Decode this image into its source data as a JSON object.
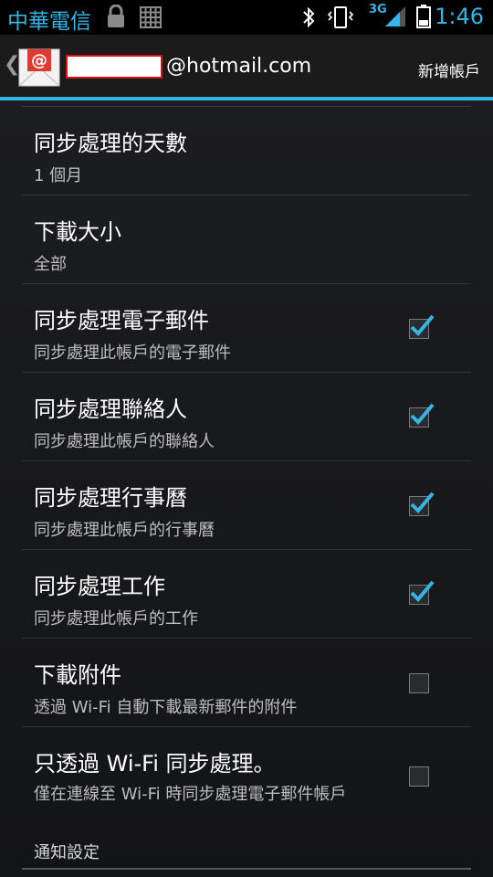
{
  "status_bar": {
    "carrier": "中華電信",
    "network": "3G",
    "time": "1:46"
  },
  "action_bar": {
    "account_suffix": "@hotmail.com",
    "add_account_label": "新增帳戶"
  },
  "settings": [
    {
      "title": "同步處理的天數",
      "summary": "1 個月",
      "has_checkbox": false
    },
    {
      "title": "下載大小",
      "summary": "全部",
      "has_checkbox": false
    },
    {
      "title": "同步處理電子郵件",
      "summary": "同步處理此帳戶的電子郵件",
      "has_checkbox": true,
      "checked": true
    },
    {
      "title": "同步處理聯絡人",
      "summary": "同步處理此帳戶的聯絡人",
      "has_checkbox": true,
      "checked": true
    },
    {
      "title": "同步處理行事曆",
      "summary": "同步處理此帳戶的行事曆",
      "has_checkbox": true,
      "checked": true
    },
    {
      "title": "同步處理工作",
      "summary": "同步處理此帳戶的工作",
      "has_checkbox": true,
      "checked": true
    },
    {
      "title": "下載附件",
      "summary": "透過 Wi-Fi 自動下載最新郵件的附件",
      "has_checkbox": true,
      "checked": false
    },
    {
      "title": "只透過 Wi-Fi 同步處理。",
      "summary": "僅在連線至 Wi-Fi 時同步處理電子郵件帳戶",
      "has_checkbox": true,
      "checked": false
    }
  ],
  "section_header": "通知設定",
  "colors": {
    "accent": "#33b5e5",
    "background": "#1a1b1e"
  }
}
